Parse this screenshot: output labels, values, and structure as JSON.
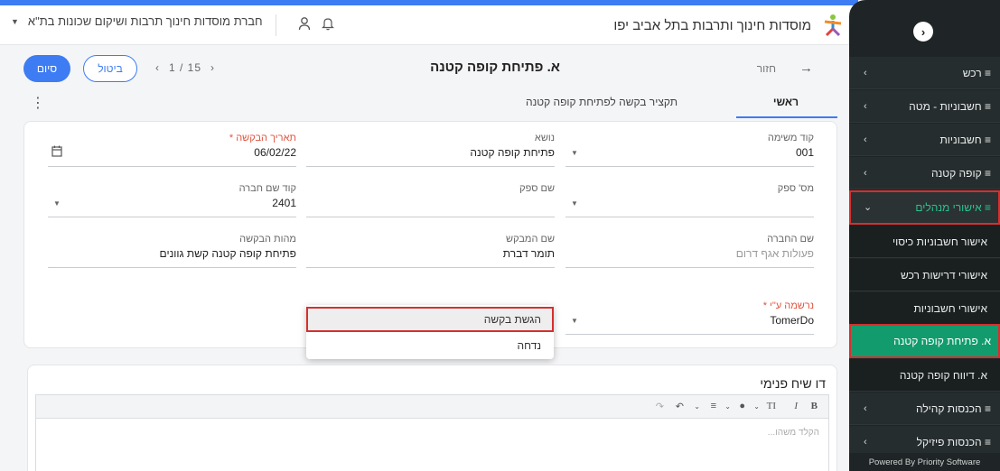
{
  "header": {
    "app_title": "מוסדות חינוך ותרבות בתל אביב יפו",
    "company": "חברת מוסדות חינוך תרבות ושיקום שכונות בת\"א",
    "icons": [
      "user-icon",
      "bell-icon",
      "dropdown-caret-icon",
      "app-logo"
    ]
  },
  "sidebar": {
    "items": [
      {
        "label": "≡ רכש",
        "type": "group"
      },
      {
        "label": "≡ חשבוניות - מטה",
        "type": "group"
      },
      {
        "label": "≡ חשבוניות",
        "type": "group"
      },
      {
        "label": "≡ קופה קטנה",
        "type": "group"
      },
      {
        "label": "≡ אישורי מנהלים",
        "type": "group",
        "state": "expanded"
      },
      {
        "label": "אישור חשבוניות כיסוי",
        "type": "sub"
      },
      {
        "label": "אישורי דרישות רכש",
        "type": "sub"
      },
      {
        "label": "אישורי חשבוניות",
        "type": "sub"
      },
      {
        "label": "א. פתיחת קופה קטנה",
        "type": "sub",
        "state": "active"
      },
      {
        "label": "א. דיווח קופה קטנה",
        "type": "sub"
      },
      {
        "label": "≡ הכנסות קהילה",
        "type": "group"
      },
      {
        "label": "≡ הכנסות פיזיקל",
        "type": "group"
      }
    ],
    "footer": "Powered By Priority Software"
  },
  "toolbar": {
    "finish_label": "סיום",
    "cancel_label": "ביטול",
    "pager_prev": "‹",
    "pager_text": "1 / 15",
    "pager_next": "›",
    "page_title": "א. פתיחת קופה קטנה",
    "back_label": "חזור"
  },
  "tabs": {
    "main": "ראשי",
    "summary": "תקציר בקשה לפתיחת קופה קטנה"
  },
  "form": {
    "list_code": {
      "label": "קוד משימה",
      "value": "001"
    },
    "subject": {
      "label": "נושא",
      "value": "פתיחת קופה קטנה"
    },
    "request_date": {
      "label": "תאריך הבקשה *",
      "value": "06/02/22"
    },
    "supplier_no": {
      "label": "מס' ספק",
      "value": ""
    },
    "supplier_name": {
      "label": "שם ספק",
      "value": ""
    },
    "company_code": {
      "label": "קוד שם חברה",
      "value": "2401"
    },
    "company_name": {
      "label": "שם החברה",
      "value": "פעולות אגף דרום"
    },
    "requester": {
      "label": "שם המבקש",
      "value": "תומר דברת"
    },
    "essence": {
      "label": "מהות הבקשה",
      "value": "פתיחת קופה קטנה קשת גוונים"
    },
    "registered_by": {
      "label": "נרשמה ע\"י *",
      "value": "TomerDo"
    }
  },
  "dropdown": {
    "options": [
      "הגשת בקשה",
      "נדחה"
    ],
    "selected": "הגשת בקשה"
  },
  "discussion": {
    "title": "דו שיח פנימי",
    "placeholder": "הקלד משהו..."
  },
  "editor_toolbar": {
    "bold": "B",
    "italic": "I",
    "text_size": "TI",
    "undo": "↶",
    "redo": "↷"
  }
}
